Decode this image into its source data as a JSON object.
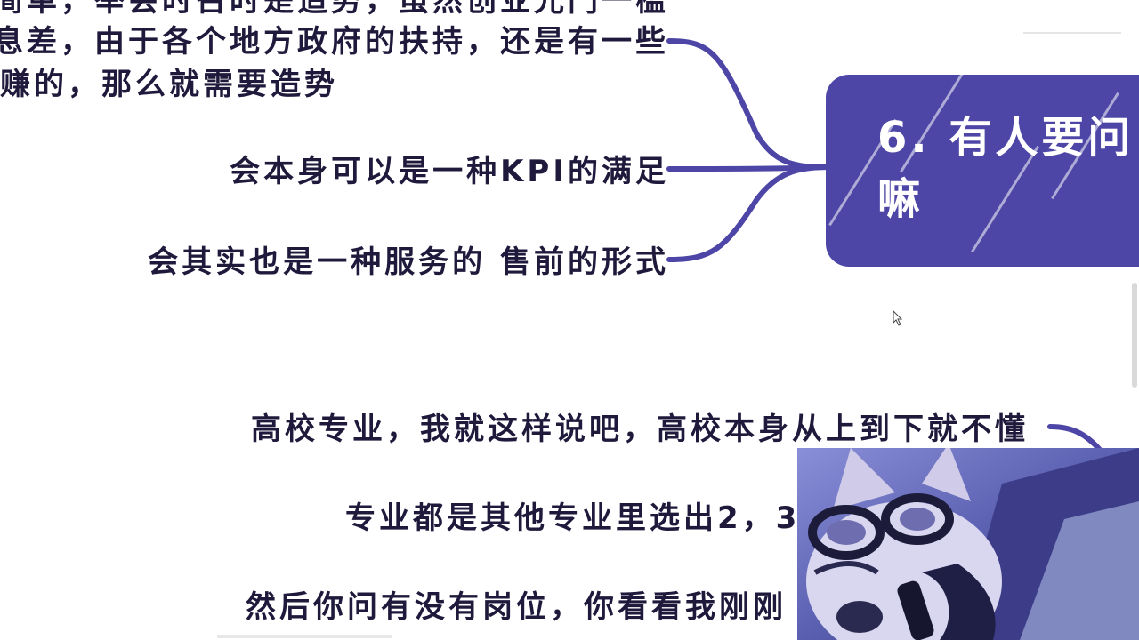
{
  "mindmap": {
    "branch_top": {
      "line1": "简单，举会时召时是造势，虽然创业光门一槛",
      "line2": "息差，由于各个地方政府的扶持，还是有一些",
      "line3": "赚的，那么就需要造势"
    },
    "branch_kpi": "会本身可以是一种KPI的满足",
    "branch_presale": "会其实也是一种服务的 售前的形式",
    "topic": {
      "line1": "6. 有人要问",
      "line2": "嘛",
      "color": "#4d46a6"
    },
    "lower": {
      "line1": "高校专业，我就这样说吧，高校本身从上到下就不懂",
      "line2": "专业都是其他专业里选出2，3",
      "line3": "然后你问有没有岗位，你看看我刚刚"
    },
    "connector_color": "#4d46a6"
  },
  "webcam": {
    "icon": "shiba-avatar-icon"
  }
}
